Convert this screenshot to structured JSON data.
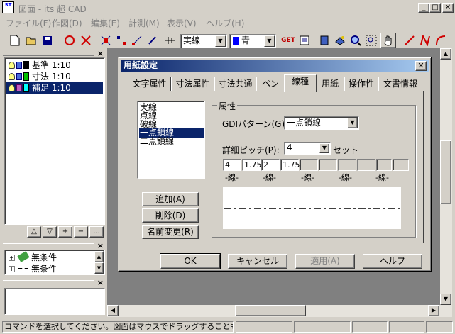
{
  "window": {
    "title": "図面 - its 超 CAD",
    "app_icon_text": "ST",
    "minimize": "_",
    "maximize": "□",
    "close": "✕"
  },
  "menu": [
    "ファイル(F)",
    "作図(D)",
    "編集(E)",
    "計測(M)",
    "表示(V)",
    "ヘルプ(H)"
  ],
  "toolbar": {
    "line_type": "実線",
    "color": "青",
    "get_label": "GET",
    "colors": {
      "color_swatch": "#0000ff",
      "get_text": "#c00000",
      "red_icons": "#d00000"
    }
  },
  "layers": [
    {
      "name": "基準 1:10",
      "swatch": "#000000",
      "selected": false
    },
    {
      "name": "寸法 1:10",
      "swatch": "#00c000",
      "selected": false
    },
    {
      "name": "補足 1:10",
      "swatch": "#00ffff",
      "selected": true
    }
  ],
  "layer_buttons": [
    "△",
    "▽",
    "+",
    "−",
    "..."
  ],
  "conditions": [
    {
      "label": "無条件",
      "icon": "pencil-icon"
    },
    {
      "label": "無条件",
      "icon": "dashed-line-icon"
    }
  ],
  "dialog": {
    "title": "用紙設定",
    "close": "✕",
    "tabs": [
      "文字属性",
      "寸法属性",
      "寸法共通",
      "ペン",
      "線種",
      "用紙",
      "操作性",
      "文書情報"
    ],
    "active_tab": "線種",
    "line_types": [
      "実線",
      "点線",
      "破線",
      "一点鎖線",
      "二点鎖線"
    ],
    "selected_line_type": "一点鎖線",
    "list_buttons": {
      "add": "追加(A)",
      "delete": "削除(D)",
      "rename": "名前変更(R)"
    },
    "attributes": {
      "group_label": "属性",
      "gdi_pattern_label": "GDIパターン(G):",
      "gdi_pattern_value": "一点鎖線",
      "pitch_label": "詳細ピッチ(P):",
      "pitch_value": "4",
      "pitch_unit": "セット",
      "cells": [
        "4",
        "1.75",
        "2",
        "1.75",
        "",
        "",
        "",
        "",
        "",
        ""
      ],
      "cell_labels": [
        "-線-",
        "-線-",
        "-線-",
        "-線-",
        "-線-"
      ]
    },
    "buttons": {
      "ok": "OK",
      "cancel": "キャンセル",
      "apply": "適用(A)",
      "help": "ヘルプ"
    }
  },
  "status": {
    "message": "コマンドを選択してください。図面はマウスでドラッグすることもできます。("
  }
}
